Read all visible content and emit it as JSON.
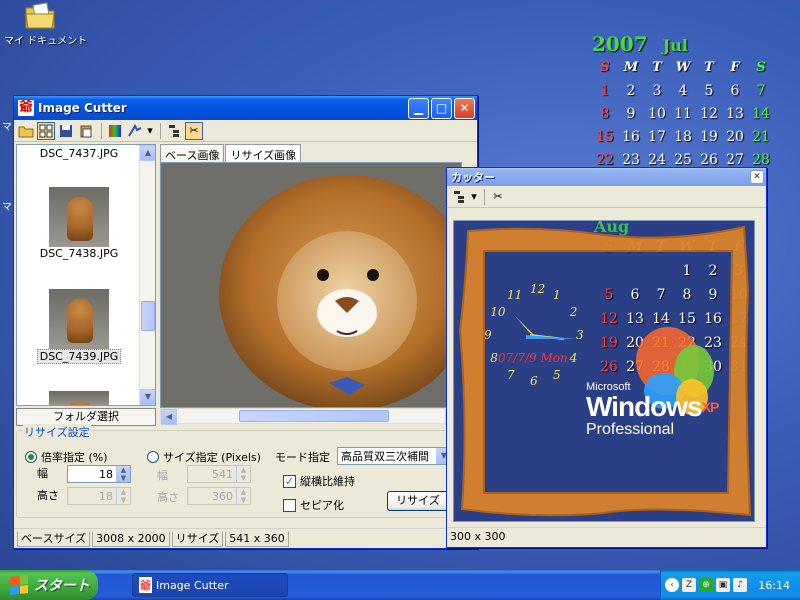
{
  "desktop": {
    "icon_label": "マイ ドキュメント",
    "edge_marks": [
      "マ",
      "マ"
    ]
  },
  "calendar": {
    "year": "2007",
    "month": "Jul",
    "dow": [
      "S",
      "M",
      "T",
      "W",
      "T",
      "F",
      "S"
    ],
    "rows": [
      [
        "1",
        "2",
        "3",
        "4",
        "5",
        "6",
        "7"
      ],
      [
        "8",
        "9",
        "10",
        "11",
        "12",
        "13",
        "14"
      ],
      [
        "15",
        "16",
        "17",
        "18",
        "19",
        "20",
        "21"
      ],
      [
        "22",
        "23",
        "24",
        "25",
        "26",
        "27",
        "28"
      ]
    ],
    "colors": {
      "sunday": "#ff4040",
      "saturday": "#40ff40",
      "header": "#3fe03f"
    }
  },
  "main_window": {
    "title": "Image Cutter",
    "title_icon": "爺",
    "toolbar": [
      "open-folder-icon",
      "thumbnail-view-icon",
      "save-icon",
      "paste-icon",
      "color-icon",
      "effects-icon",
      "dropdown-arrow-icon",
      "tree-icon",
      "scissors-icon"
    ],
    "files": [
      {
        "name": "DSC_7437.JPG"
      },
      {
        "name": "DSC_7438.JPG"
      },
      {
        "name": "DSC_7439.JPG"
      }
    ],
    "folder_button": "フォルダ選択",
    "tabs": [
      "ベース画像",
      "リサイズ画像"
    ],
    "resize_group": {
      "title": "リサイズ設定",
      "ratio_label": "倍率指定 (%)",
      "width_label": "幅",
      "height_label": "高さ",
      "ratio_width": "18",
      "ratio_height": "18",
      "size_label": "サイズ指定 (Pixels)",
      "size_width_label": "幅",
      "size_height_label": "高さ",
      "size_width": "541",
      "size_height": "360",
      "mode_label": "モード指定",
      "mode_value": "高品質双三次補間",
      "keep_aspect": "縦横比維持",
      "sepia": "セピア化",
      "resize_button": "リサイズ"
    },
    "status": {
      "base_label": "ベースサイズ",
      "base_value": "3008 x 2000",
      "resize_label": "リサイズ",
      "resize_value": "541 x 360"
    }
  },
  "cutter_window": {
    "title": "カッター",
    "calendar": {
      "month_partial": "Aug",
      "dow": [
        "S",
        "M",
        "T",
        "W",
        "T",
        "F",
        "S"
      ],
      "rows": [
        [
          "",
          "",
          "",
          "1",
          "2",
          "3",
          "4"
        ],
        [
          "5",
          "6",
          "7",
          "8",
          "9",
          "10",
          "11"
        ],
        [
          "12",
          "13",
          "14",
          "15",
          "16",
          "17",
          "18"
        ],
        [
          "19",
          "20",
          "21",
          "22",
          "23",
          "24",
          "25"
        ],
        [
          "26",
          "27",
          "28",
          "29",
          "30",
          "31",
          ""
        ]
      ]
    },
    "clock_numbers": [
      "12",
      "1",
      "2",
      "3",
      "4",
      "5",
      "6",
      "7",
      "8",
      "9",
      "10",
      "11"
    ],
    "clock_date": "07/7/9 Mon",
    "logo": {
      "microsoft": "Microsoft",
      "windows": "Windows",
      "xp": "XP",
      "edition": "Professional"
    },
    "status": "300 x 300"
  },
  "taskbar": {
    "start_label": "スタート",
    "task_title": "Image Cutter",
    "task_icon": "爺",
    "tray_icons": [
      "chevron-left-icon",
      "z-icon",
      "network-icon",
      "monitor-icon",
      "speaker-icon"
    ],
    "clock": "16:14"
  }
}
